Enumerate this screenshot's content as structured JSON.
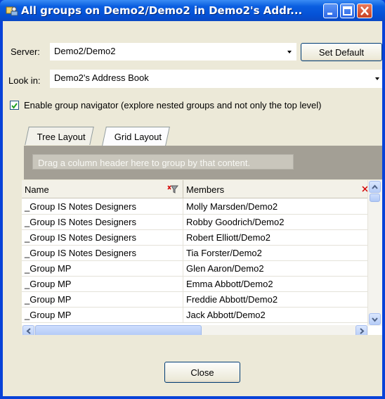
{
  "window": {
    "title": "All groups on Demo2/Demo2 in Demo2's Addr..."
  },
  "form": {
    "server_label": "Server:",
    "server_value": "Demo2/Demo2",
    "set_default_label": "Set Default",
    "lookin_label": "Look in:",
    "lookin_value": "Demo2's Address Book",
    "navigator_checked": true,
    "navigator_label": "Enable group navigator (explore nested groups and not only the top level)"
  },
  "tabs": [
    {
      "label": "Tree Layout",
      "active": false
    },
    {
      "label": "Grid Layout",
      "active": true
    }
  ],
  "group_by_hint": "Drag a column header here to group by that content.",
  "grid": {
    "columns": [
      "Name",
      "Members"
    ],
    "rows": [
      [
        "_Group IS Notes Designers",
        "Molly Marsden/Demo2"
      ],
      [
        "_Group IS Notes Designers",
        "Robby Goodrich/Demo2"
      ],
      [
        "_Group IS Notes Designers",
        "Robert Elliott/Demo2"
      ],
      [
        "_Group IS Notes Designers",
        "Tia Forster/Demo2"
      ],
      [
        "_Group MP",
        "Glen Aaron/Demo2"
      ],
      [
        "_Group MP",
        "Emma Abbott/Demo2"
      ],
      [
        "_Group MP",
        "Freddie Abbott/Demo2"
      ],
      [
        "_Group MP",
        "Jack Abbott/Demo2"
      ]
    ]
  },
  "close_label": "Close",
  "colors": {
    "titlebar": "#0a5ee0",
    "face": "#ece9d8",
    "group_area": "#a39f95"
  }
}
